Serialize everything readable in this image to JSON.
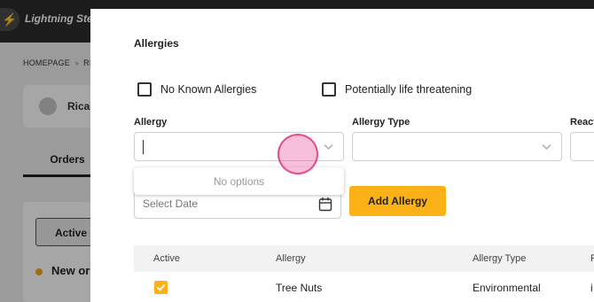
{
  "app": {
    "brand": "Lightning Step",
    "breadcrumb": [
      "HOMEPAGE",
      "RI"
    ],
    "breadcrumb_separator": "»",
    "patient_name": "Ricar",
    "tab_label": "Orders",
    "active_button_label": "Active O",
    "new_order_label": "New or"
  },
  "modal": {
    "title": "Allergies",
    "checkboxes": [
      {
        "label": "No Known Allergies",
        "checked": false
      },
      {
        "label": "Potentially life threatening",
        "checked": false
      }
    ],
    "fields": {
      "allergy_label": "Allergy",
      "allergy_type_label": "Allergy Type",
      "reaction_label": "React"
    },
    "dropdown_message": "No options",
    "date_placeholder": "Select Date",
    "add_button_label": "Add Allergy",
    "table": {
      "headers": [
        "Active",
        "Allergy",
        "Allergy Type",
        "F"
      ],
      "rows": [
        {
          "active": true,
          "allergy": "Tree Nuts",
          "allergy_type": "Environmental",
          "extra": "i"
        }
      ]
    }
  },
  "colors": {
    "accent": "#fbb217",
    "topbar": "#2b2b2b",
    "tap_indicator": "#ec4899"
  },
  "icons": {
    "logo": "lightning-icon",
    "dropdown": "chevron-down-icon",
    "date": "calendar-icon",
    "avatar": "user-icon"
  }
}
